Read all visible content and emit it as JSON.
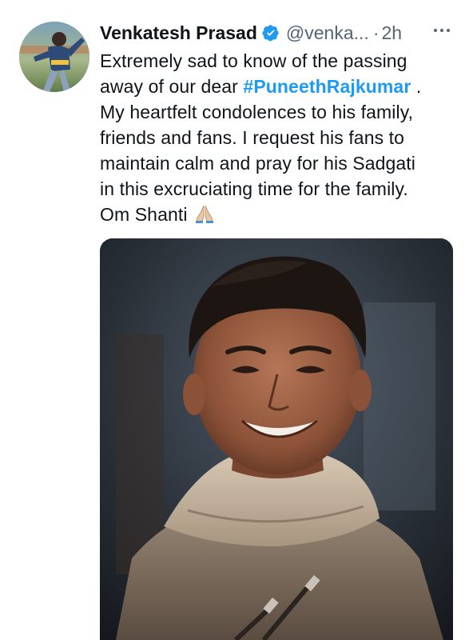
{
  "tweet": {
    "author_name": "Venkatesh Prasad",
    "handle": "@venka...",
    "separator": "·",
    "time": "2h",
    "text_line1": "Extremely sad to know of the passing",
    "text_line2_pre": "away of our dear ",
    "hashtag": "#PuneethRajkumar",
    "text_line2_post": " .",
    "text_line3": "My heartfelt condolences to his family,",
    "text_line4": "friends and fans. I request his fans to",
    "text_line5": "maintain calm and pray for his Sadgati",
    "text_line6": "in this excruciating time for the family.",
    "text_line7": "Om Shanti",
    "emoji": "folded-hands"
  },
  "icons": {
    "verified": "verified-badge-icon",
    "more": "more-options-icon"
  },
  "colors": {
    "link": "#1d9bf0",
    "secondary_text": "#536471",
    "primary_text": "#0f1419"
  }
}
